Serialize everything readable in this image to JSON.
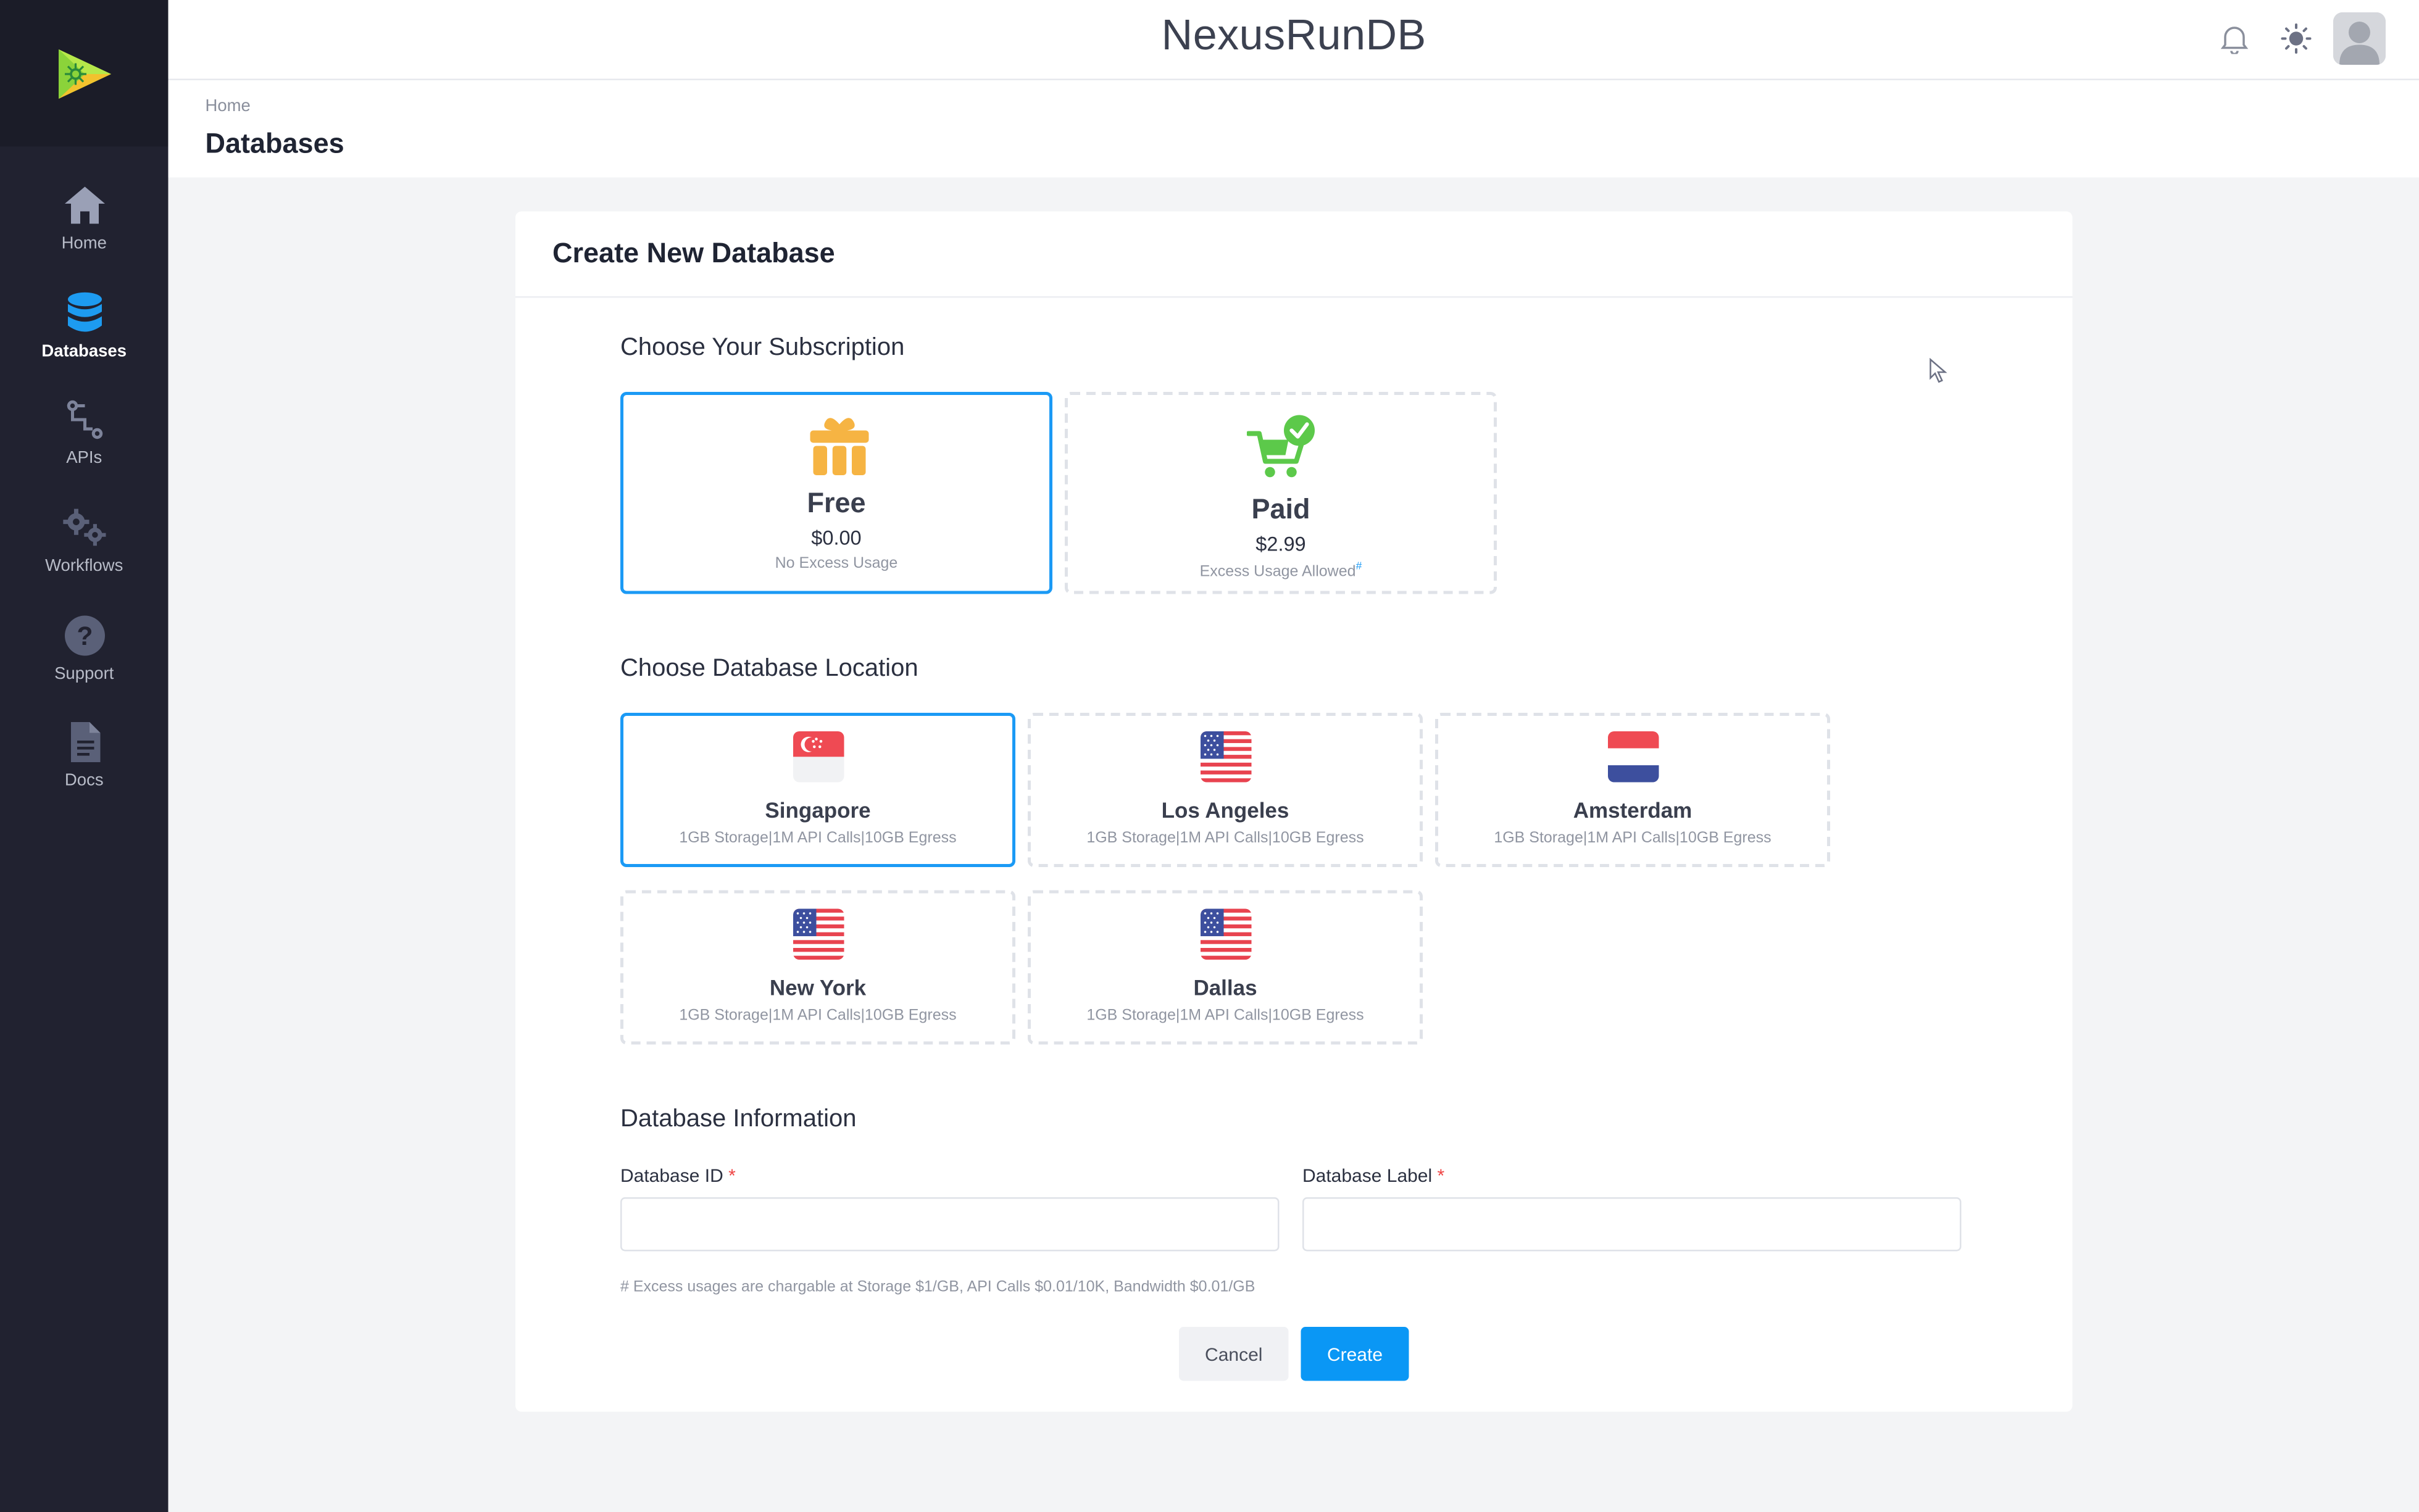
{
  "app": {
    "title": "NexusRunDB"
  },
  "sidebar": {
    "items": [
      {
        "label": "Home",
        "icon": "home-icon"
      },
      {
        "label": "Databases",
        "icon": "database-icon",
        "active": true
      },
      {
        "label": "APIs",
        "icon": "api-icon"
      },
      {
        "label": "Workflows",
        "icon": "gears-icon"
      },
      {
        "label": "Support",
        "icon": "help-icon"
      },
      {
        "label": "Docs",
        "icon": "document-icon"
      }
    ]
  },
  "header": {
    "icons": [
      "bell-icon",
      "sun-icon",
      "avatar"
    ]
  },
  "breadcrumb": {
    "home": "Home"
  },
  "page": {
    "title": "Databases"
  },
  "form": {
    "title": "Create New Database",
    "subscription_title": "Choose Your Subscription",
    "subscriptions": [
      {
        "name": "Free",
        "price": "$0.00",
        "note": "No Excess Usage",
        "selected": true,
        "icon": "gift-icon"
      },
      {
        "name": "Paid",
        "price": "$2.99",
        "note": "Excess Usage Allowed",
        "note_mark": "#",
        "selected": false,
        "icon": "cart-check-icon"
      }
    ],
    "location_title": "Choose Database Location",
    "locations": [
      {
        "name": "Singapore",
        "spec": "1GB Storage|1M API Calls|10GB Egress",
        "flag": "singapore-flag-icon",
        "selected": true
      },
      {
        "name": "Los Angeles",
        "spec": "1GB Storage|1M API Calls|10GB Egress",
        "flag": "usa-flag-icon",
        "selected": false
      },
      {
        "name": "Amsterdam",
        "spec": "1GB Storage|1M API Calls|10GB Egress",
        "flag": "netherlands-flag-icon",
        "selected": false
      },
      {
        "name": "New York",
        "spec": "1GB Storage|1M API Calls|10GB Egress",
        "flag": "usa-flag-icon",
        "selected": false
      },
      {
        "name": "Dallas",
        "spec": "1GB Storage|1M API Calls|10GB Egress",
        "flag": "usa-flag-icon",
        "selected": false
      }
    ],
    "info_title": "Database Information",
    "db_id": {
      "label": "Database ID",
      "required_mark": "*",
      "value": ""
    },
    "db_label": {
      "label": "Database Label",
      "required_mark": "*",
      "value": ""
    },
    "footnote": "# Excess usages are chargable at Storage $1/GB, API Calls $0.01/10K, Bandwidth $0.01/GB",
    "cancel_label": "Cancel",
    "create_label": "Create"
  },
  "colors": {
    "sidebar_bg": "#212230",
    "accent": "#0a97f5",
    "selected_border": "#1b9af5",
    "free_icon": "#f6b443",
    "paid_icon": "#5cc94a"
  }
}
